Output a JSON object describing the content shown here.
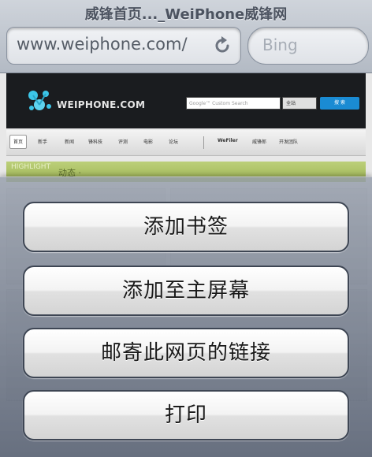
{
  "browser": {
    "page_title": "威锋首页..._WeiPhone威锋网",
    "url": "www.weiphone.com/",
    "search_placeholder": "Bing",
    "reload_icon": "reload-icon"
  },
  "webpage": {
    "logo_text": "WEIPHONE.COM",
    "site_search_placeholder": "Google™ Custom Search",
    "site_search_option": "全站",
    "site_search_button": "搜 索",
    "nav": [
      "首页",
      "新手",
      "新闻",
      "锋科技",
      "评测",
      "电影",
      "论坛",
      "WeFiler",
      "威锋郎",
      "开发团队"
    ],
    "highlight_tag": "HIGHLIGHT",
    "highlight_snippet": "动态 ·"
  },
  "action_sheet": {
    "buttons": [
      "添加书签",
      "添加至主屏幕",
      "邮寄此网页的链接",
      "打印"
    ]
  }
}
